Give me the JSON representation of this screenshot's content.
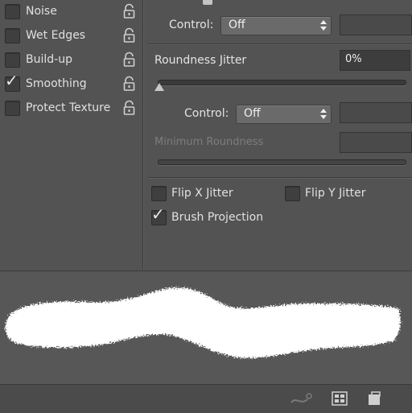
{
  "left_options": [
    {
      "label": "Noise",
      "checked": false
    },
    {
      "label": "Wet Edges",
      "checked": false
    },
    {
      "label": "Build-up",
      "checked": false
    },
    {
      "label": "Smoothing",
      "checked": true
    },
    {
      "label": "Protect Texture",
      "checked": false
    }
  ],
  "top_control": {
    "label": "Control:",
    "value": "Off"
  },
  "roundness_jitter": {
    "label": "Roundness Jitter",
    "value": "0%",
    "level": 0
  },
  "roundness_control": {
    "label": "Control:",
    "value": "Off"
  },
  "minimum_roundness": {
    "label": "Minimum Roundness",
    "disabled": true
  },
  "flip_x": {
    "label": "Flip X Jitter",
    "checked": false
  },
  "flip_y": {
    "label": "Flip Y Jitter",
    "checked": false
  },
  "brush_projection": {
    "label": "Brush Projection",
    "checked": true
  },
  "bottom_icons": [
    "brush-preview-toggle-icon",
    "grid-panel-icon",
    "new-preset-icon"
  ],
  "colors": {
    "panel": "#535353",
    "field": "#3d3d3d",
    "stroke": "#ffffff"
  }
}
